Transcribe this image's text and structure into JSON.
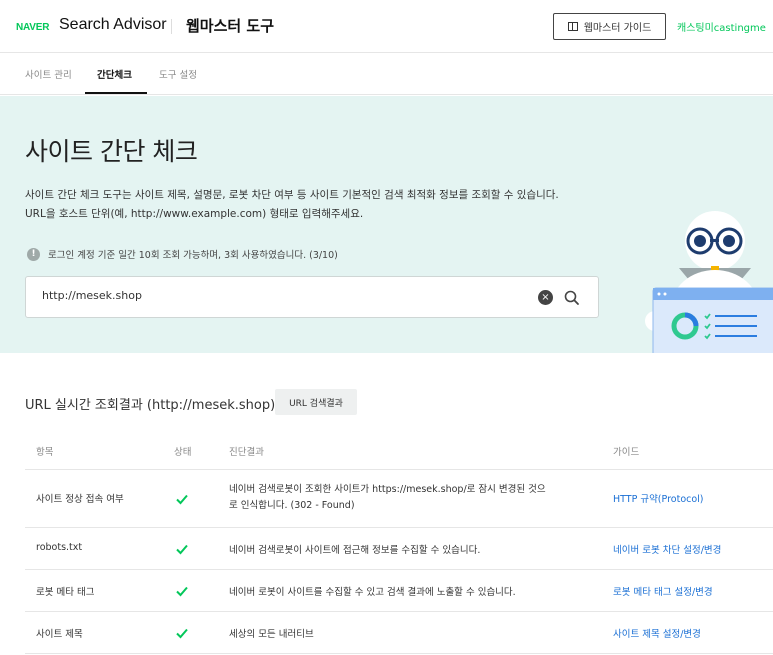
{
  "header": {
    "logo": "NAVER",
    "brand": "Search Advisor",
    "product": "웹마스터 도구",
    "guide_button": "웹마스터 가이드",
    "user": "캐스팅미castingme"
  },
  "tabs": [
    {
      "label": "사이트 관리"
    },
    {
      "label": "간단체크"
    },
    {
      "label": "도구 설정"
    }
  ],
  "hero": {
    "title": "사이트 간단 체크",
    "desc_line1": "사이트 간단 체크 도구는 사이트 제목, 설명문, 로봇 차단 여부 등 사이트 기본적인 검색 최적화 정보를 조회할 수 있습니다.",
    "desc_line2": "URL을 호스트 단위(예, http://www.example.com) 형태로 입력해주세요.",
    "notice": "로그인 계정 기준 일간 10회 조회 가능하며, 3회 사용하였습니다. (3/10)",
    "search_value": "http://mesek.shop"
  },
  "results": {
    "title": "URL 실시간 조회결과 (http://mesek.shop)",
    "button": "URL 검색결과",
    "columns": [
      "항목",
      "상태",
      "진단결과",
      "가이드"
    ],
    "rows": [
      {
        "item": "사이트 정상 접속 여부",
        "status": "ok",
        "result_line1": "네이버 검색로봇이 조회한 사이트가 https://mesek.shop/로 잠시 변경된 것으",
        "result_line2": "로 인식합니다. (302 - Found)",
        "guide": "HTTP 규약(Protocol)"
      },
      {
        "item": "robots.txt",
        "status": "ok",
        "result_line1": "네이버 검색로봇이 사이트에 접근해 정보를 수집할 수 있습니다.",
        "result_line2": "",
        "guide": "네이버 로봇 차단 설정/변경"
      },
      {
        "item": "로봇 메타 태그",
        "status": "ok",
        "result_line1": "네이버 로봇이 사이트를 수집할 수 있고 검색 결과에 노출할 수 있습니다.",
        "result_line2": "",
        "guide": "로봇 메타 태그 설정/변경"
      },
      {
        "item": "사이트 제목",
        "status": "ok",
        "result_line1": "세상의 모든 내러티브",
        "result_line2": "",
        "guide": "사이트 제목 설정/변경"
      }
    ]
  },
  "colors": {
    "accent": "#03c75a",
    "hero_bg": "#e4f4f2",
    "link": "#1a6fd4",
    "check": "#03c75a"
  }
}
